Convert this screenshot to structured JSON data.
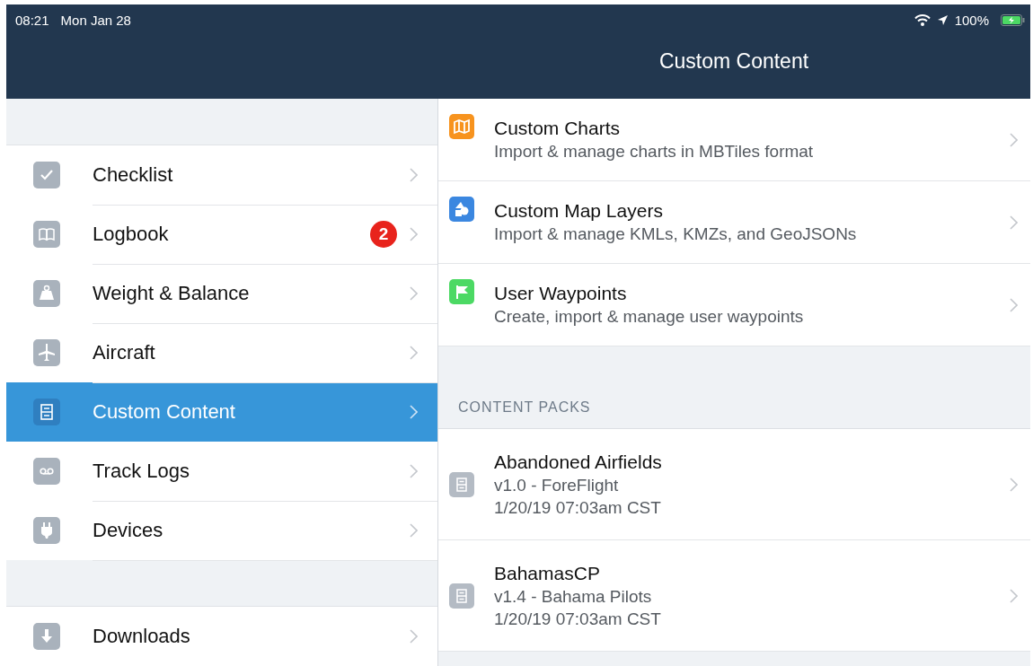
{
  "status_bar": {
    "time": "08:21",
    "date": "Mon Jan 28",
    "battery": "100%"
  },
  "nav_bar": {
    "title": "Custom Content"
  },
  "sidebar": {
    "groups": [
      {
        "items": [
          {
            "label": "Checklist",
            "selected": false
          },
          {
            "label": "Logbook",
            "selected": false,
            "badge": "2"
          },
          {
            "label": "Weight & Balance",
            "selected": false
          },
          {
            "label": "Aircraft",
            "selected": false
          },
          {
            "label": "Custom Content",
            "selected": true
          },
          {
            "label": "Track Logs",
            "selected": false
          },
          {
            "label": "Devices",
            "selected": false
          }
        ]
      },
      {
        "items": [
          {
            "label": "Downloads",
            "selected": false
          }
        ]
      }
    ]
  },
  "content": {
    "items": [
      {
        "title": "Custom Charts",
        "subtitle": "Import & manage charts in MBTiles format",
        "color": "#f7931e"
      },
      {
        "title": "Custom Map Layers",
        "subtitle": "Import & manage KMLs, KMZs, and GeoJSONs",
        "color": "#3b87e0"
      },
      {
        "title": "User Waypoints",
        "subtitle": "Create, import & manage user waypoints",
        "color": "#4cd964"
      }
    ],
    "section_header": "CONTENT PACKS",
    "packs": [
      {
        "name": "Abandoned Airfields",
        "version": "v1.0 - ForeFlight",
        "date": "1/20/19 07:03am CST"
      },
      {
        "name": "BahamasCP",
        "version": "v1.4 - Bahama Pilots",
        "date": "1/20/19 07:03am CST"
      }
    ]
  }
}
